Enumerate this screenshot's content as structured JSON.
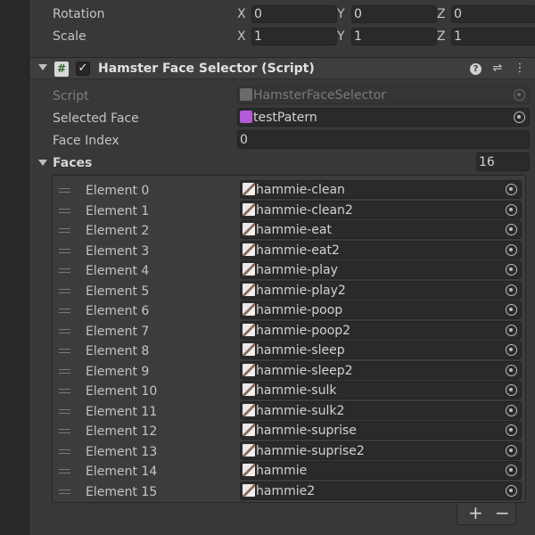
{
  "transform": {
    "rotation": {
      "label": "Rotation",
      "x_label": "X",
      "y_label": "Y",
      "z_label": "Z",
      "x": "0",
      "y": "0",
      "z": "0"
    },
    "scale": {
      "label": "Scale",
      "x_label": "X",
      "y_label": "Y",
      "z_label": "Z",
      "x": "1",
      "y": "1",
      "z": "1"
    }
  },
  "component": {
    "title": "Hamster Face Selector (Script)",
    "script_icon_glyph": "#",
    "enabled": true,
    "check_glyph": "✓",
    "help_glyph": "?",
    "settings_glyph": "⇌",
    "menu_glyph": "⋮",
    "script": {
      "label": "Script",
      "value": "HamsterFaceSelector"
    },
    "selected_face": {
      "label": "Selected Face",
      "value": "testPatern",
      "icon_color": "#b25bd7"
    },
    "face_index": {
      "label": "Face Index",
      "value": "0"
    },
    "faces": {
      "label": "Faces",
      "size": "16",
      "elements": [
        {
          "label": "Element 0",
          "value": "hammie-clean"
        },
        {
          "label": "Element 1",
          "value": "hammie-clean2"
        },
        {
          "label": "Element 2",
          "value": "hammie-eat"
        },
        {
          "label": "Element 3",
          "value": "hammie-eat2"
        },
        {
          "label": "Element 4",
          "value": "hammie-play"
        },
        {
          "label": "Element 5",
          "value": "hammie-play2"
        },
        {
          "label": "Element 6",
          "value": "hammie-poop"
        },
        {
          "label": "Element 7",
          "value": "hammie-poop2"
        },
        {
          "label": "Element 8",
          "value": "hammie-sleep"
        },
        {
          "label": "Element 9",
          "value": "hammie-sleep2"
        },
        {
          "label": "Element 10",
          "value": "hammie-sulk"
        },
        {
          "label": "Element 11",
          "value": "hammie-sulk2"
        },
        {
          "label": "Element 12",
          "value": "hammie-suprise"
        },
        {
          "label": "Element 13",
          "value": "hammie-suprise2"
        },
        {
          "label": "Element 14",
          "value": "hammie"
        },
        {
          "label": "Element 15",
          "value": "hammie2"
        }
      ],
      "add_glyph": "+",
      "remove_glyph": "−"
    }
  }
}
